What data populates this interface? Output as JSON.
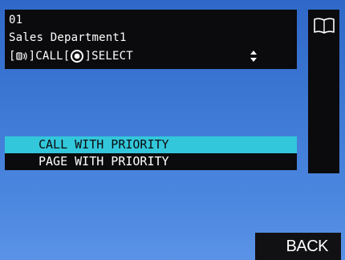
{
  "header": {
    "number": "01",
    "name": "Sales Department1",
    "hint_call_label": "CALL",
    "hint_select_label": "SELECT",
    "bracket_open": "[",
    "bracket_close": "]",
    "hint_call_icon": "speaker-icon",
    "hint_select_icon": "target-icon",
    "scroll_indicator_icon": "up-down-arrows-icon"
  },
  "side_panel": {
    "icon": "book-icon"
  },
  "menu": {
    "items": [
      {
        "label": "CALL WITH PRIORITY",
        "selected": true
      },
      {
        "label": "PAGE WITH PRIORITY",
        "selected": false
      }
    ]
  },
  "footer": {
    "back_label": "BACK"
  },
  "colors": {
    "panel_bg": "#0b0b0d",
    "highlight": "#33c7dc",
    "background_top": "#2f68c8",
    "background_bottom": "#5a93e6"
  }
}
